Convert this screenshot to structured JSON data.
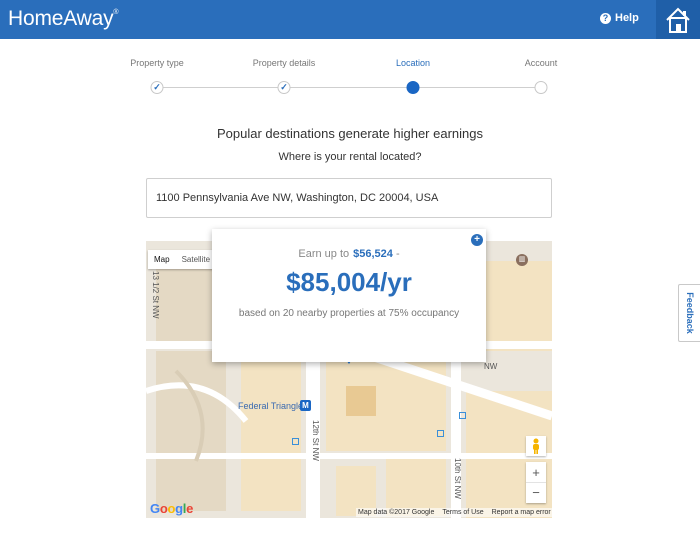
{
  "header": {
    "brand": "HomeAway",
    "help_label": "Help",
    "accent": "#2a6ebb"
  },
  "steps": [
    {
      "label": "Property type",
      "state": "done"
    },
    {
      "label": "Property details",
      "state": "done"
    },
    {
      "label": "Location",
      "state": "current"
    },
    {
      "label": "Account",
      "state": "todo"
    }
  ],
  "content": {
    "headline": "Popular destinations generate higher earnings",
    "question": "Where is your rental located?",
    "address_value": "1100 Pennsylvania Ave NW, Washington, DC 20004, USA"
  },
  "estimate": {
    "earn_prefix": "Earn up to",
    "low_value": "$56,524",
    "dash": "-",
    "high_value": "$85,004/yr",
    "basis": "based on 20 nearby properties at 75% occupancy"
  },
  "map": {
    "tabs": [
      "Map",
      "Satellite"
    ],
    "place_label": "Federal Triangle",
    "streets": [
      "12th St NW",
      "10th St NW",
      "13 1/2 St NW",
      "NW"
    ],
    "footer": {
      "data": "Map data ©2017 Google",
      "terms": "Terms of Use",
      "report": "Report a map error"
    },
    "zoom_in": "+",
    "zoom_out": "−",
    "google_logo": "Google"
  },
  "feedback_label": "Feedback"
}
